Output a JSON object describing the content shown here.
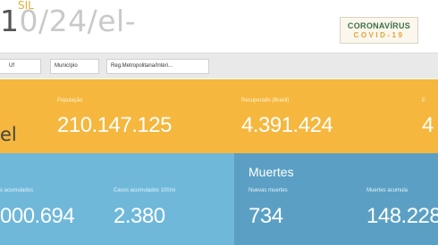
{
  "overlay": {
    "url_lead": "1",
    "url_sup": "SIL",
    "url_text": "0/24/el-",
    "el_text": "el",
    "el_dash": "–"
  },
  "brand": {
    "line1": "CORONAVÍRUS",
    "line2": "COVID-19"
  },
  "filters": {
    "uf": "Uf",
    "municipio": "Município",
    "region": "Reg.Metropolitana/Interi..."
  },
  "stats_top": [
    {
      "label": "População",
      "value": "210.147.125"
    },
    {
      "label": "Recuperado (Brasil)",
      "value": "4.391.424"
    },
    {
      "label": "E",
      "value": "4"
    }
  ],
  "stats_bottom": {
    "cases_label": "s acumulados",
    "cases_value": "000.694",
    "cases100_label": "Casos acumulados 100mi",
    "cases100_value": "2.380",
    "deaths_title": "Muertes",
    "new_deaths_label": "Nuevas muertes",
    "new_deaths_value": "734",
    "total_deaths_label": "Muertes acumula",
    "total_deaths_value": "148.228"
  },
  "colors": {
    "orange": "#f5b73d",
    "blue": "#6fb8da",
    "blue_dark": "#5ba0c4",
    "brand_green": "#3d6f4a",
    "brand_orange": "#e2a43a"
  }
}
